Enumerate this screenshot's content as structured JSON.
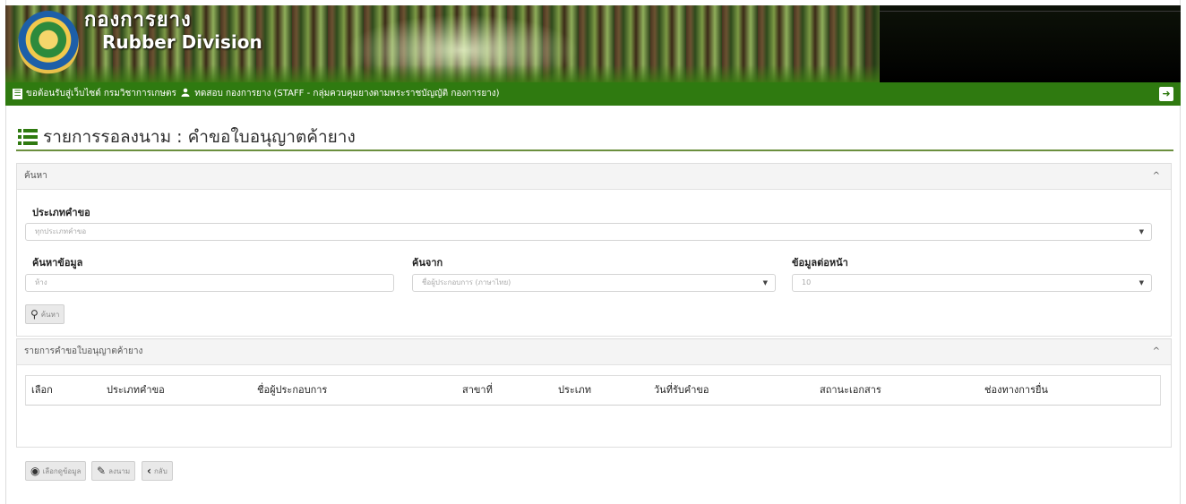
{
  "header": {
    "logo_th": "กองการยาง",
    "logo_en": "Rubber Division",
    "welcome_text": "ขอต้อนรับสู่เว็บไซต์ กรมวิชาการเกษตร",
    "user_text": "ทดสอบ กองการยาง (STAFF - กลุ่มควบคุมยางตามพระราชบัญญัติ กองการยาง)"
  },
  "page": {
    "title": "รายการรอลงนาม : คำขอใบอนุญาตค้ายาง"
  },
  "search_panel": {
    "header": "ค้นหา",
    "request_type_label": "ประเภทคำขอ",
    "request_type_value": "ทุกประเภทคำขอ",
    "keyword_label": "ค้นหาข้อมูล",
    "keyword_placeholder": "ห้าง",
    "search_from_label": "ค้นจาก",
    "search_from_value": "ชื่อผู้ประกอบการ (ภาษาไทย)",
    "per_page_label": "ข้อมูลต่อหน้า",
    "per_page_value": "10",
    "search_button": "ค้นหา"
  },
  "results_panel": {
    "header": "รายการคำขอใบอนุญาตค้ายาง",
    "columns": [
      "เลือก",
      "ประเภทคำขอ",
      "ชื่อผู้ประกอบการ",
      "สาขาที่",
      "ประเภท",
      "วันที่รับคำขอ",
      "สถานะเอกสาร",
      "ช่องทางการยื่น"
    ]
  },
  "actions": {
    "view_label": "เลือกดูข้อมูล",
    "sign_label": "ลงนาม",
    "back_label": "กลับ"
  },
  "colors": {
    "brand_green": "#2f7a10"
  }
}
